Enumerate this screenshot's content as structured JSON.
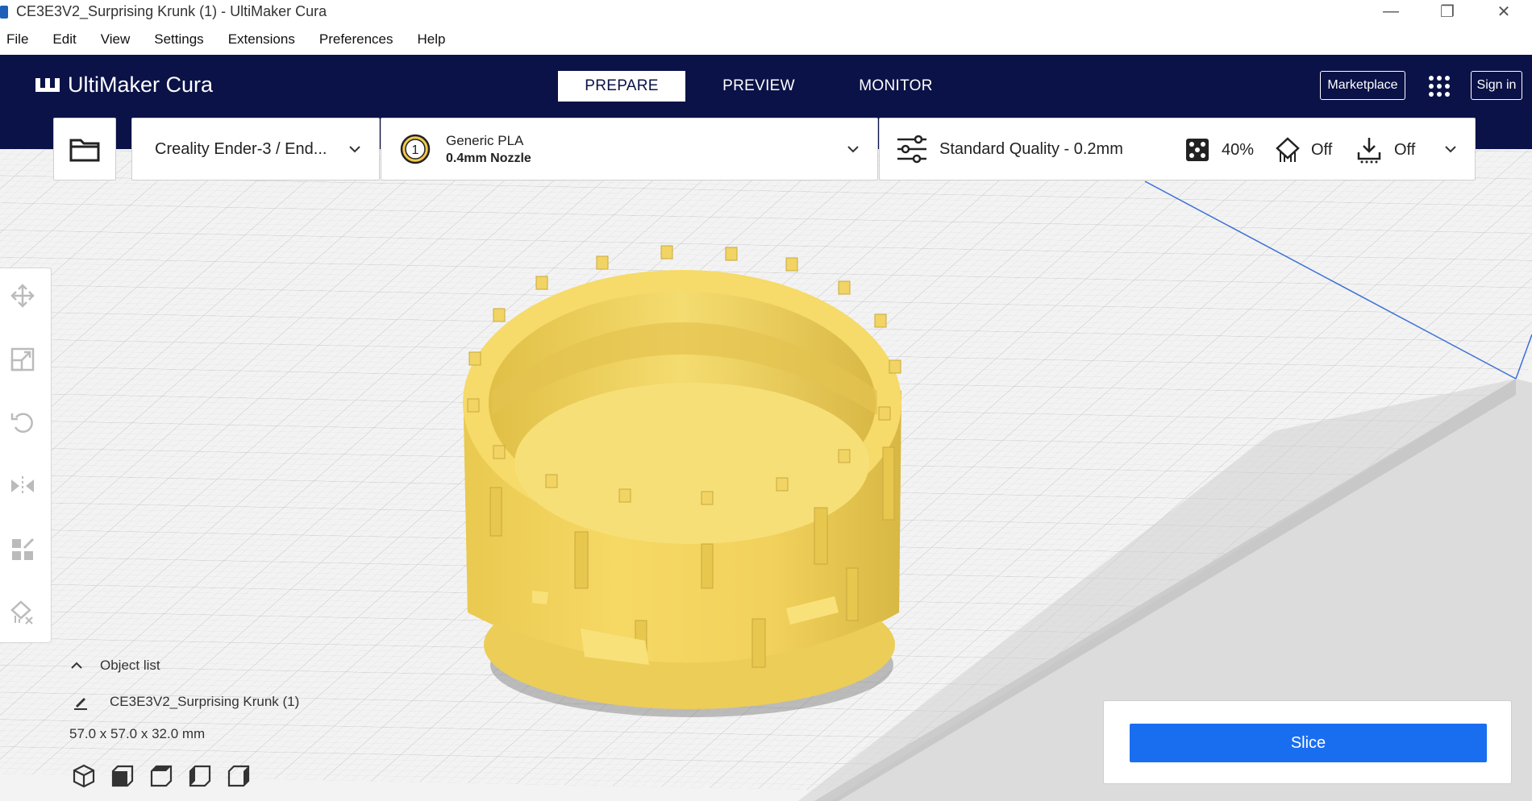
{
  "window": {
    "title": "CE3E3V2_Surprising Krunk (1) - UltiMaker Cura",
    "controls": [
      "minimize-icon",
      "restore-icon",
      "close-icon"
    ]
  },
  "menu": [
    "File",
    "Edit",
    "View",
    "Settings",
    "Extensions",
    "Preferences",
    "Help"
  ],
  "header": {
    "logo_text": "UltiMaker Cura",
    "stages": [
      {
        "label": "PREPARE",
        "active": true
      },
      {
        "label": "PREVIEW",
        "active": false
      },
      {
        "label": "MONITOR",
        "active": false
      }
    ],
    "marketplace_label": "Marketplace",
    "signin_label": "Sign in"
  },
  "toolbar": {
    "printer": "Creality Ender-3 / End...",
    "material_index": "1",
    "material_name": "Generic PLA",
    "nozzle": "0.4mm Nozzle",
    "quality": "Standard Quality - 0.2mm",
    "infill": "40%",
    "support": "Off",
    "adhesion": "Off"
  },
  "object_list": {
    "toggle_label": "Object list",
    "item_name": "CE3E3V2_Surprising Krunk (1)",
    "dimensions": "57.0 x 57.0 x 32.0 mm"
  },
  "slice": {
    "label": "Slice"
  },
  "colors": {
    "header_bg": "#0b1247",
    "accent": "#196ef0",
    "model": "#f7dc6f"
  }
}
